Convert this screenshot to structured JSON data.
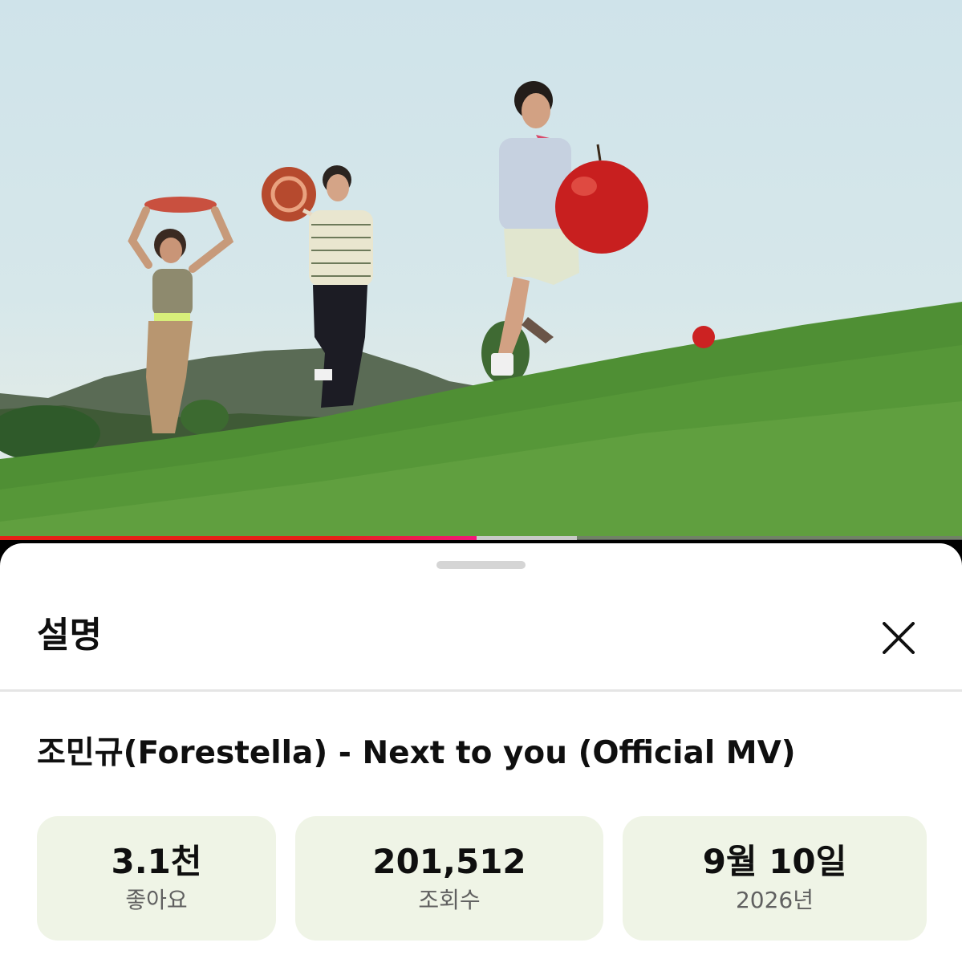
{
  "player": {
    "scene": "music-video-frame",
    "progress_played": 0.495,
    "progress_buffered": 0.6,
    "accent_color": "#e62117"
  },
  "sheet": {
    "title": "설명",
    "close_icon": "close-icon"
  },
  "video": {
    "title": "조민규(Forestella) - Next to you (Official MV)"
  },
  "stats": [
    {
      "value": "3.1천",
      "label": "좋아요"
    },
    {
      "value": "201,512",
      "label": "조회수"
    },
    {
      "value": "9월 10일",
      "label": "2026년"
    }
  ]
}
